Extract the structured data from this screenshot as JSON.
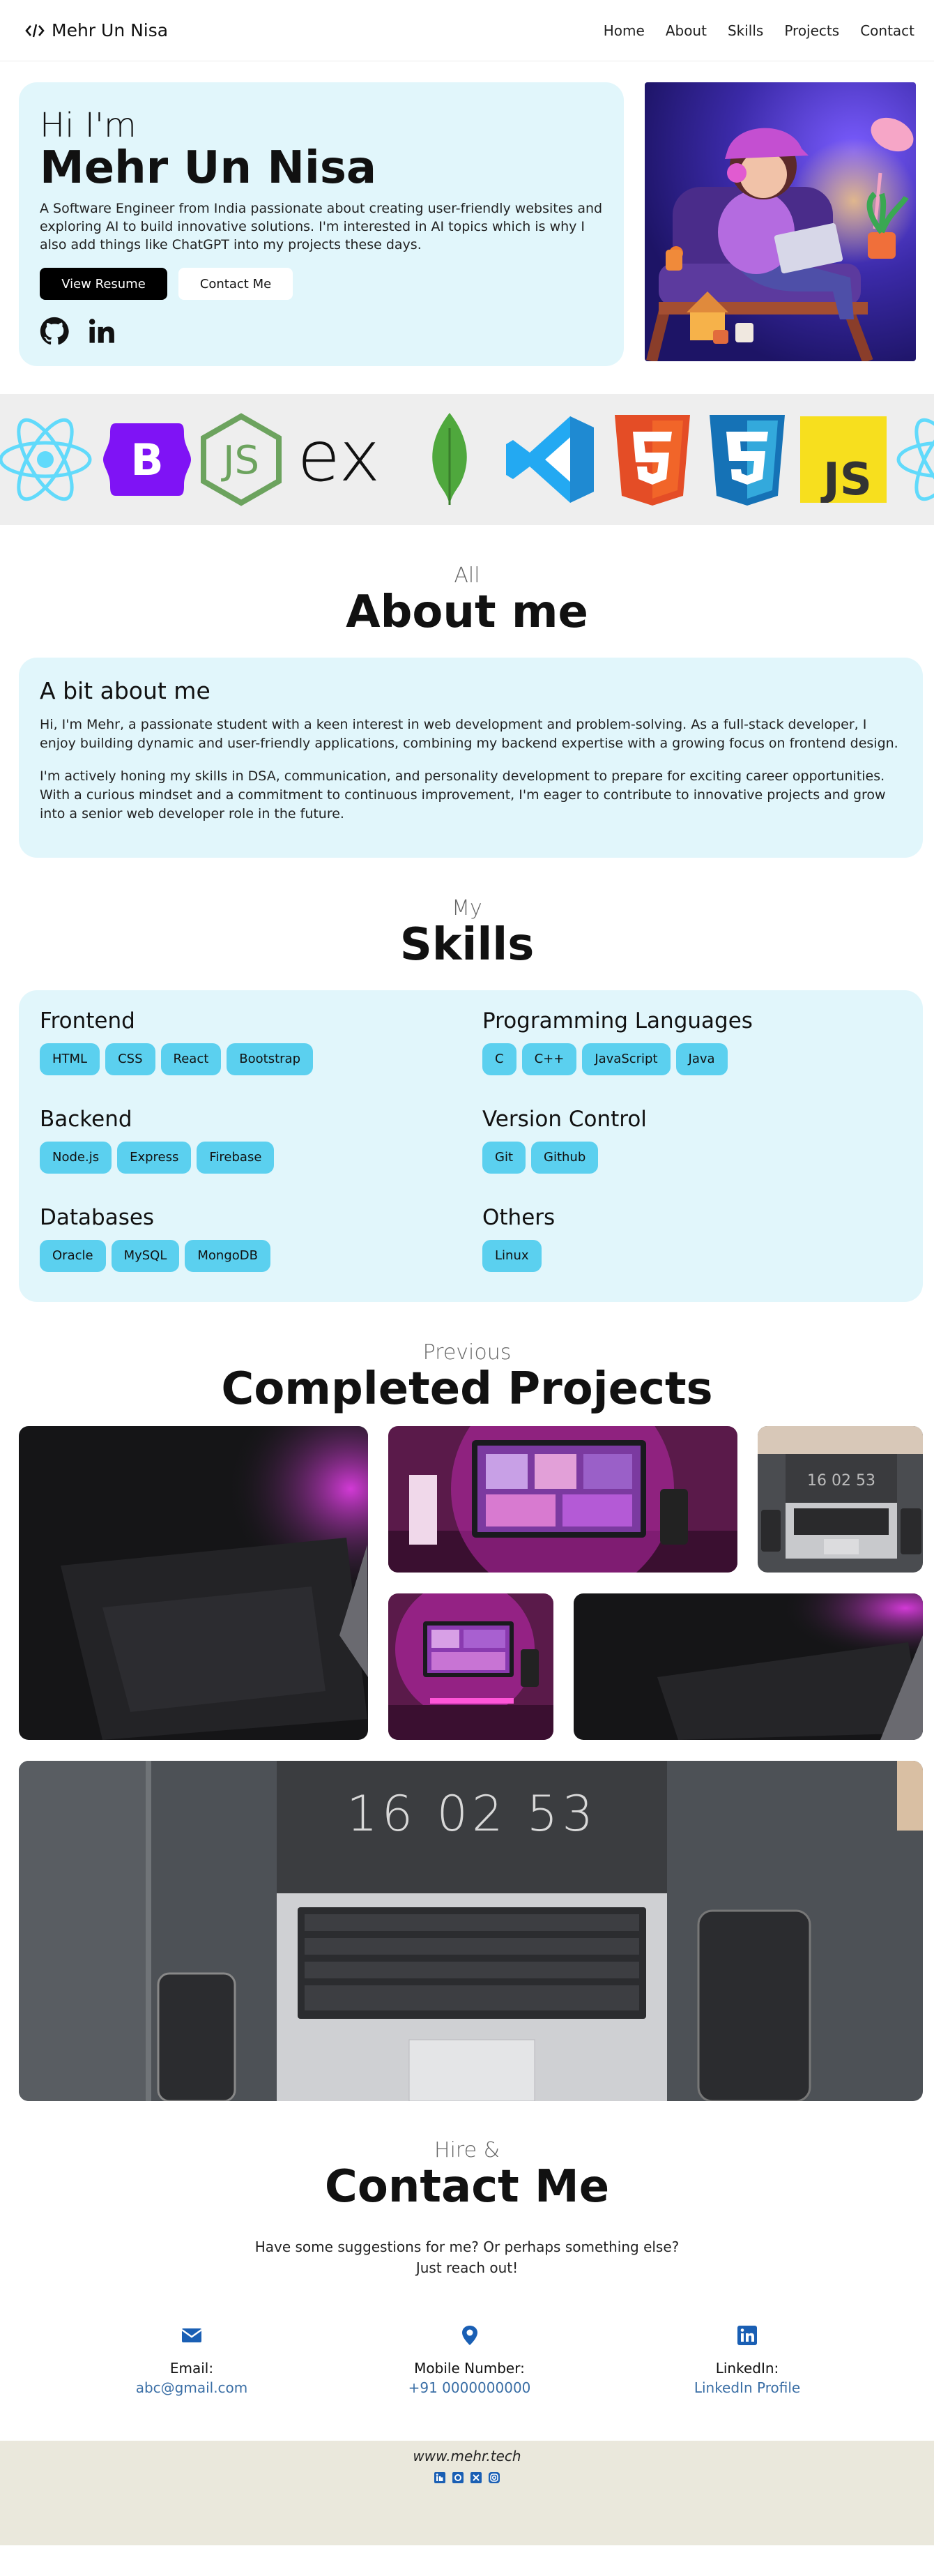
{
  "nav": {
    "brand": "Mehr Un Nisa",
    "links": [
      "Home",
      "About",
      "Skills",
      "Projects",
      "Contact"
    ]
  },
  "hero": {
    "greeting": "Hi I'm",
    "name": "Mehr Un Nisa",
    "description": "A Software Engineer from India passionate about creating user-friendly websites and exploring AI to build innovative solutions. I'm interested in AI topics which is why I also add things like ChatGPT into my projects these days.",
    "resume_button": "View Resume",
    "contact_button": "Contact Me"
  },
  "tech_logos": [
    "react-logo",
    "bootstrap-logo",
    "nodejs-logo",
    "express-logo",
    "mongodb-logo",
    "vscode-logo",
    "html5-logo",
    "css3-logo",
    "javascript-logo",
    "react-logo"
  ],
  "about": {
    "subtitle": "All",
    "title": "About me",
    "card_title": "A bit about me",
    "para1": "Hi, I'm Mehr, a passionate student with a keen interest in web development and problem-solving. As a full-stack developer, I enjoy building dynamic and user-friendly applications, combining my backend expertise with a growing focus on frontend design.",
    "para2": "I'm actively honing my skills in DSA, communication, and personality development to prepare for exciting career opportunities. With a curious mindset and a commitment to continuous improvement, I'm eager to contribute to innovative projects and grow into a senior web developer role in the future."
  },
  "skills": {
    "subtitle": "My",
    "title": "Skills",
    "groups": [
      {
        "name": "Frontend",
        "items": [
          "HTML",
          "CSS",
          "React",
          "Bootstrap"
        ]
      },
      {
        "name": "Programming Languages",
        "items": [
          "C",
          "C++",
          "JavaScript",
          "Java"
        ]
      },
      {
        "name": "Backend",
        "items": [
          "Node.js",
          "Express",
          "Firebase"
        ]
      },
      {
        "name": "Version Control",
        "items": [
          "Git",
          "Github"
        ]
      },
      {
        "name": "Databases",
        "items": [
          "Oracle",
          "MySQL",
          "MongoDB"
        ]
      },
      {
        "name": "Others",
        "items": [
          "Linux"
        ]
      }
    ]
  },
  "projects": {
    "subtitle": "Previous",
    "title": "Completed Projects",
    "clock_text": "16 02 53"
  },
  "contact": {
    "subtitle": "Hire &",
    "title": "Contact Me",
    "intro_line1": "Have some suggestions for me? Or perhaps something else?",
    "intro_line2": "Just reach out!",
    "email_label": "Email:",
    "email_value": "abc@gmail.com",
    "phone_label": "Mobile Number:",
    "phone_value": "+91 0000000000",
    "linkedin_label": "LinkedIn:",
    "linkedin_value": "LinkedIn Profile"
  },
  "footer": {
    "site": "www.mehr.tech"
  },
  "colors": {
    "card_bg": "#e1f6fb",
    "chip_bg": "#5bd0ef",
    "link_blue": "#3a6ea5",
    "icon_blue": "#1a5fb4",
    "footer_bg": "#eae8dc"
  }
}
